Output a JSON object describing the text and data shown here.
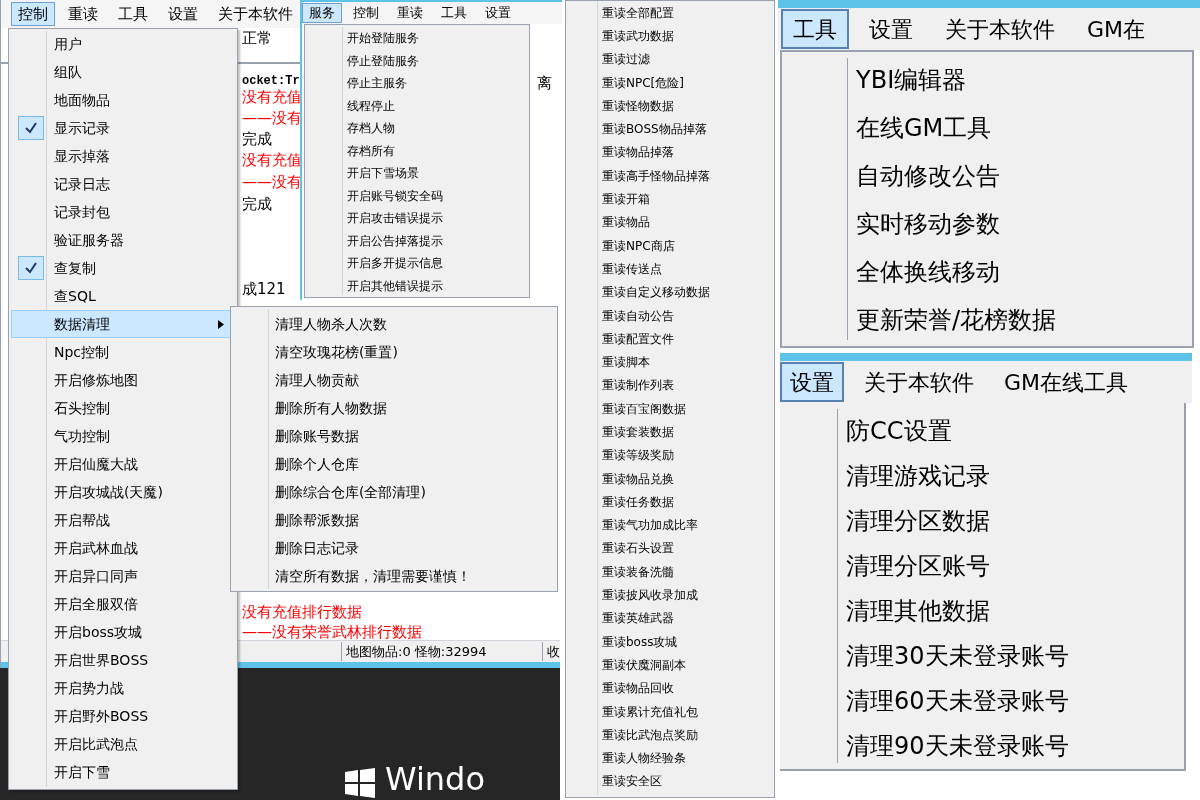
{
  "main_window": {
    "menu_bar": [
      {
        "label": "控制",
        "selected": true
      },
      {
        "label": "重读",
        "selected": false
      },
      {
        "label": "工具",
        "selected": false
      },
      {
        "label": "设置",
        "selected": false
      },
      {
        "label": "关于本软件",
        "selected": false
      }
    ],
    "status": "正常",
    "log_lines": [
      {
        "text": "ocket:Tr",
        "color": "#000000"
      },
      {
        "text": "没有充值",
        "color": "#ff0000"
      },
      {
        "text": "——没有",
        "color": "#ff0000"
      },
      {
        "text": "完成",
        "color": "#000000"
      },
      {
        "text": "没有充值",
        "color": "#ff0000"
      },
      {
        "text": "——没有",
        "color": "#ff0000"
      },
      {
        "text": "完成",
        "color": "#000000"
      },
      {
        "text": "成121",
        "color": "#000000"
      },
      {
        "text": "没有充值排行数据",
        "color": "#ff0000"
      },
      {
        "text": "——没有荣誉武林排行数据",
        "color": "#ff0000"
      }
    ],
    "side_fragment": "离",
    "status_bar": [
      "地图物品:0  怪物:32994",
      "收"
    ],
    "desktop": {
      "caption": "Windo"
    }
  },
  "control_menu": {
    "items": [
      {
        "label": "用户",
        "checked": false,
        "selected": false,
        "submenu": false
      },
      {
        "label": "组队",
        "checked": false,
        "selected": false,
        "submenu": false
      },
      {
        "label": "地面物品",
        "checked": false,
        "selected": false,
        "submenu": false
      },
      {
        "label": "显示记录",
        "checked": true,
        "selected": false,
        "submenu": false
      },
      {
        "label": "显示掉落",
        "checked": false,
        "selected": false,
        "submenu": false
      },
      {
        "label": "记录日志",
        "checked": false,
        "selected": false,
        "submenu": false
      },
      {
        "label": "记录封包",
        "checked": false,
        "selected": false,
        "submenu": false
      },
      {
        "label": "验证服务器",
        "checked": false,
        "selected": false,
        "submenu": false
      },
      {
        "label": "查复制",
        "checked": true,
        "selected": false,
        "submenu": false
      },
      {
        "label": "查SQL",
        "checked": false,
        "selected": false,
        "submenu": false
      },
      {
        "label": "数据清理",
        "checked": false,
        "selected": true,
        "submenu": true
      },
      {
        "label": "Npc控制",
        "checked": false,
        "selected": false,
        "submenu": false
      },
      {
        "label": "开启修炼地图",
        "checked": false,
        "selected": false,
        "submenu": false
      },
      {
        "label": "石头控制",
        "checked": false,
        "selected": false,
        "submenu": false
      },
      {
        "label": "气功控制",
        "checked": false,
        "selected": false,
        "submenu": false
      },
      {
        "label": "开启仙魔大战",
        "checked": false,
        "selected": false,
        "submenu": false
      },
      {
        "label": "开启攻城战(天魔)",
        "checked": false,
        "selected": false,
        "submenu": false
      },
      {
        "label": "开启帮战",
        "checked": false,
        "selected": false,
        "submenu": false
      },
      {
        "label": "开启武林血战",
        "checked": false,
        "selected": false,
        "submenu": false
      },
      {
        "label": "开启异口同声",
        "checked": false,
        "selected": false,
        "submenu": false
      },
      {
        "label": "开启全服双倍",
        "checked": false,
        "selected": false,
        "submenu": false
      },
      {
        "label": "开启boss攻城",
        "checked": false,
        "selected": false,
        "submenu": false
      },
      {
        "label": "开启世界BOSS",
        "checked": false,
        "selected": false,
        "submenu": false
      },
      {
        "label": "开启势力战",
        "checked": false,
        "selected": false,
        "submenu": false
      },
      {
        "label": "开启野外BOSS",
        "checked": false,
        "selected": false,
        "submenu": false
      },
      {
        "label": "开启比武泡点",
        "checked": false,
        "selected": false,
        "submenu": false
      },
      {
        "label": "开启下雪",
        "checked": false,
        "selected": false,
        "submenu": false
      }
    ]
  },
  "data_cleanup_submenu": {
    "items": [
      "清理人物杀人次数",
      "清空玫瑰花榜(重置)",
      "清理人物贡献",
      "删除所有人物数据",
      "删除账号数据",
      "删除个人仓库",
      "删除综合仓库(全部清理)",
      "删除帮派数据",
      "删除日志记录",
      "清空所有数据，清理需要谨慎！"
    ]
  },
  "service_window": {
    "menu_bar": [
      {
        "label": "服务",
        "selected": true
      },
      {
        "label": "控制",
        "selected": false
      },
      {
        "label": "重读",
        "selected": false
      },
      {
        "label": "工具",
        "selected": false
      },
      {
        "label": "设置",
        "selected": false
      }
    ],
    "menu_items": [
      "开始登陆服务",
      "停止登陆服务",
      "停止主服务",
      "线程停止",
      "存档人物",
      "存档所有",
      "开启下雪场景",
      "开启账号锁安全码",
      "开启攻击错误提示",
      "开启公告掉落提示",
      "开启多开提示信息",
      "开启其他错误提示"
    ]
  },
  "reload_menu": {
    "items": [
      "重读全部配置",
      "重读武功数据",
      "重读过滤",
      "重读NPC[危险]",
      "重读怪物数据",
      "重读BOSS物品掉落",
      "重读物品掉落",
      "重读高手怪物品掉落",
      "重读开箱",
      "重读物品",
      "重读NPC商店",
      "重读传送点",
      "重读自定义移动数据",
      "重读自动公告",
      "重读配置文件",
      "重读脚本",
      "重读制作列表",
      "重读百宝阁数据",
      "重读套装数据",
      "重读等级奖励",
      "重读物品兑换",
      "重读任务数据",
      "重读气功加成比率",
      "重读石头设置",
      "重读装备洗髓",
      "重读披风收录加成",
      "重读英雄武器",
      "重读boss攻城",
      "重读伏魔洞副本",
      "重读物品回收",
      "重读累计充值礼包",
      "重读比武泡点奖励",
      "重读人物经验条",
      "重读安全区"
    ]
  },
  "tools_window": {
    "menu_bar": [
      {
        "label": "工具",
        "selected": true
      },
      {
        "label": "设置",
        "selected": false
      },
      {
        "label": "关于本软件",
        "selected": false
      },
      {
        "label": "GM在",
        "selected": false
      }
    ],
    "menu_items": [
      "YBI编辑器",
      "在线GM工具",
      "自动修改公告",
      "实时移动参数",
      "全体换线移动",
      "更新荣誉/花榜数据"
    ]
  },
  "settings_window": {
    "menu_bar": [
      {
        "label": "设置",
        "selected": true
      },
      {
        "label": "关于本软件",
        "selected": false
      },
      {
        "label": "GM在线工具",
        "selected": false
      }
    ],
    "menu_items": [
      "防CC设置",
      "清理游戏记录",
      "清理分区数据",
      "清理分区账号",
      "清理其他数据",
      "清理30天未登录账号",
      "清理60天未登录账号",
      "清理90天未登录账号"
    ]
  }
}
